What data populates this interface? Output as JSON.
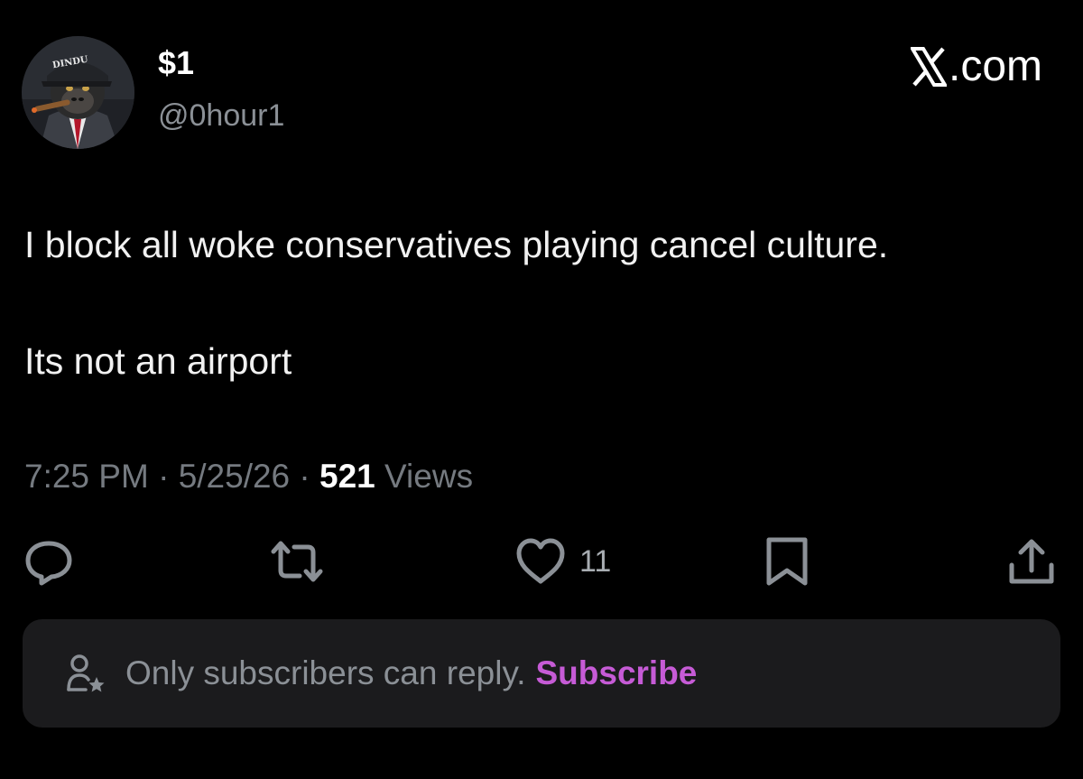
{
  "author": {
    "display_name": "$1",
    "handle": "@0hour1",
    "avatar_cap_text": "DINDU"
  },
  "brand": {
    "label": ".com",
    "icon": "x-logo-icon"
  },
  "tweet": {
    "line1": "I block all woke conservatives playing cancel culture.",
    "line2": "Its not an airport"
  },
  "meta": {
    "time": "7:25 PM",
    "date": "5/25/26",
    "views_count": "521",
    "views_label": "Views",
    "separator": "·"
  },
  "actions": {
    "reply_icon": "reply-icon",
    "repost_icon": "repost-icon",
    "like_icon": "heart-icon",
    "like_count": "11",
    "bookmark_icon": "bookmark-icon",
    "share_icon": "share-icon"
  },
  "reply_restriction": {
    "icon": "person-star-icon",
    "text": "Only subscribers can reply.",
    "link": "Subscribe"
  },
  "colors": {
    "background": "#000000",
    "text_primary": "#f1f1f1",
    "text_secondary": "#8b9096",
    "subscribe_accent": "#c65bd6",
    "banner_bg": "#1b1b1d"
  }
}
